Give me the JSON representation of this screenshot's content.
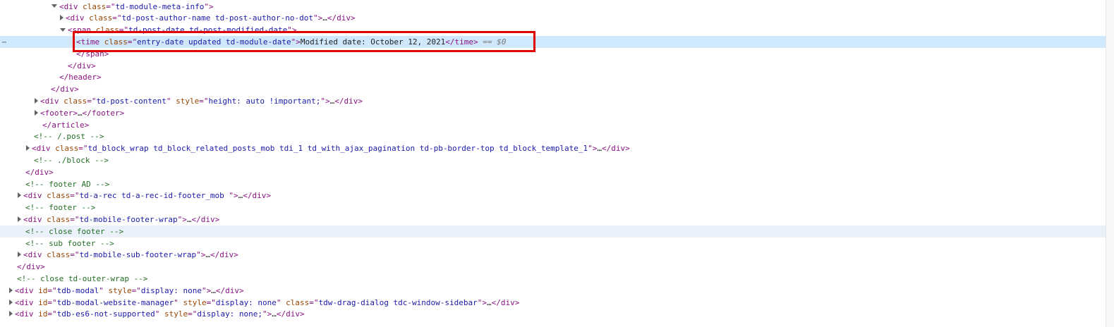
{
  "colors": {
    "tag": "#881280",
    "attr_name": "#994500",
    "attr_value": "#1a1aa6",
    "comment": "#236e25",
    "selected_row": "#cfe8fc",
    "highlight_box": "#e00000"
  },
  "gutter_dots": "⋯",
  "lines": [
    {
      "indent": 84,
      "tri": "open",
      "parts": [
        [
          "tag",
          "<div "
        ],
        [
          "an",
          "class"
        ],
        [
          "tag",
          "=\""
        ],
        [
          "av",
          "td-module-meta-info"
        ],
        [
          "tag",
          "\">"
        ]
      ]
    },
    {
      "indent": 96,
      "tri": "closed",
      "parts": [
        [
          "tag",
          "<div "
        ],
        [
          "an",
          "class"
        ],
        [
          "tag",
          "=\""
        ],
        [
          "av",
          "td-post-author-name td-post-author-no-dot"
        ],
        [
          "tag",
          "\">"
        ],
        [
          "ell",
          "…"
        ],
        [
          "tag",
          "</div>"
        ]
      ]
    },
    {
      "indent": 96,
      "tri": "open",
      "parts": [
        [
          "tag",
          "<span "
        ],
        [
          "an",
          "class"
        ],
        [
          "tag",
          "=\""
        ],
        [
          "av",
          "td-post-date td-post-modified-date"
        ],
        [
          "tag",
          "\">"
        ]
      ]
    },
    {
      "indent": 108,
      "tri": "none",
      "selected": true,
      "parts": [
        [
          "tag",
          "<time "
        ],
        [
          "an",
          "class"
        ],
        [
          "tag",
          "=\""
        ],
        [
          "av",
          "entry-date updated td-module-date"
        ],
        [
          "tag",
          "\">"
        ],
        [
          "txt",
          "Modified date: October 12, 2021"
        ],
        [
          "tag",
          "</time>"
        ],
        [
          "eq",
          " == $0"
        ]
      ]
    },
    {
      "indent": 108,
      "tri": "none",
      "parts": [
        [
          "tag",
          "</span>"
        ]
      ]
    },
    {
      "indent": 96,
      "tri": "none",
      "parts": [
        [
          "tag",
          "</div>"
        ]
      ]
    },
    {
      "indent": 84,
      "tri": "none",
      "parts": [
        [
          "tag",
          "</header>"
        ]
      ]
    },
    {
      "indent": 72,
      "tri": "none",
      "parts": [
        [
          "tag",
          "</div>"
        ]
      ]
    },
    {
      "indent": 60,
      "tri": "closed",
      "parts": [
        [
          "tag",
          "<div "
        ],
        [
          "an",
          "class"
        ],
        [
          "tag",
          "=\""
        ],
        [
          "av",
          "td-post-content"
        ],
        [
          "tag",
          "\" "
        ],
        [
          "an",
          "style"
        ],
        [
          "tag",
          "=\""
        ],
        [
          "av",
          "height: auto !important;"
        ],
        [
          "tag",
          "\">"
        ],
        [
          "ell",
          "…"
        ],
        [
          "tag",
          "</div>"
        ]
      ]
    },
    {
      "indent": 60,
      "tri": "closed",
      "parts": [
        [
          "tag",
          "<footer>"
        ],
        [
          "ell",
          "…"
        ],
        [
          "tag",
          "</footer>"
        ]
      ]
    },
    {
      "indent": 60,
      "tri": "none",
      "parts": [
        [
          "tag",
          "</article>"
        ]
      ]
    },
    {
      "indent": 48,
      "tri": "none",
      "parts": [
        [
          "cm",
          "<!-- /.post -->"
        ]
      ]
    },
    {
      "indent": 48,
      "tri": "closed",
      "parts": [
        [
          "tag",
          "<div "
        ],
        [
          "an",
          "class"
        ],
        [
          "tag",
          "=\""
        ],
        [
          "av",
          "td_block_wrap td_block_related_posts_mob tdi_1 td_with_ajax_pagination td-pb-border-top td_block_template_1"
        ],
        [
          "tag",
          "\">"
        ],
        [
          "ell",
          "…"
        ],
        [
          "tag",
          "</div>"
        ]
      ]
    },
    {
      "indent": 48,
      "tri": "none",
      "parts": [
        [
          "cm",
          "<!-- ./block -->"
        ]
      ]
    },
    {
      "indent": 36,
      "tri": "none",
      "parts": [
        [
          "tag",
          "</div>"
        ]
      ]
    },
    {
      "indent": 36,
      "tri": "none",
      "parts": [
        [
          "cm",
          "<!-- footer AD -->"
        ]
      ]
    },
    {
      "indent": 36,
      "tri": "closed",
      "parts": [
        [
          "tag",
          "<div "
        ],
        [
          "an",
          "class"
        ],
        [
          "tag",
          "=\""
        ],
        [
          "av",
          "td-a-rec td-a-rec-id-footer_mob "
        ],
        [
          "tag",
          "\">"
        ],
        [
          "ell",
          "…"
        ],
        [
          "tag",
          "</div>"
        ]
      ]
    },
    {
      "indent": 36,
      "tri": "none",
      "parts": [
        [
          "cm",
          "<!-- footer -->"
        ]
      ]
    },
    {
      "indent": 36,
      "tri": "closed",
      "parts": [
        [
          "tag",
          "<div "
        ],
        [
          "an",
          "class"
        ],
        [
          "tag",
          "=\""
        ],
        [
          "av",
          "td-mobile-footer-wrap"
        ],
        [
          "tag",
          "\">"
        ],
        [
          "ell",
          "…"
        ],
        [
          "tag",
          "</div>"
        ]
      ]
    },
    {
      "indent": 36,
      "tri": "none",
      "hover": true,
      "parts": [
        [
          "cm",
          "<!-- close footer -->"
        ]
      ]
    },
    {
      "indent": 36,
      "tri": "none",
      "parts": [
        [
          "cm",
          "<!-- sub footer -->"
        ]
      ]
    },
    {
      "indent": 36,
      "tri": "closed",
      "parts": [
        [
          "tag",
          "<div "
        ],
        [
          "an",
          "class"
        ],
        [
          "tag",
          "=\""
        ],
        [
          "av",
          "td-mobile-sub-footer-wrap"
        ],
        [
          "tag",
          "\">"
        ],
        [
          "ell",
          "…"
        ],
        [
          "tag",
          "</div>"
        ]
      ]
    },
    {
      "indent": 24,
      "tri": "none",
      "parts": [
        [
          "tag",
          "</div>"
        ]
      ]
    },
    {
      "indent": 24,
      "tri": "none",
      "parts": [
        [
          "cm",
          "<!-- close td-outer-wrap -->"
        ]
      ]
    },
    {
      "indent": 24,
      "tri": "closed",
      "parts": [
        [
          "tag",
          "<div "
        ],
        [
          "an",
          "id"
        ],
        [
          "tag",
          "=\""
        ],
        [
          "av",
          "tdb-modal"
        ],
        [
          "tag",
          "\" "
        ],
        [
          "an",
          "style"
        ],
        [
          "tag",
          "=\""
        ],
        [
          "av",
          "display: none"
        ],
        [
          "tag",
          "\">"
        ],
        [
          "ell",
          "…"
        ],
        [
          "tag",
          "</div>"
        ]
      ]
    },
    {
      "indent": 24,
      "tri": "closed",
      "parts": [
        [
          "tag",
          "<div "
        ],
        [
          "an",
          "id"
        ],
        [
          "tag",
          "=\""
        ],
        [
          "av",
          "tdb-modal-website-manager"
        ],
        [
          "tag",
          "\" "
        ],
        [
          "an",
          "style"
        ],
        [
          "tag",
          "=\""
        ],
        [
          "av",
          "display: none"
        ],
        [
          "tag",
          "\" "
        ],
        [
          "an",
          "class"
        ],
        [
          "tag",
          "=\""
        ],
        [
          "av",
          "tdw-drag-dialog tdc-window-sidebar"
        ],
        [
          "tag",
          "\">"
        ],
        [
          "ell",
          "…"
        ],
        [
          "tag",
          "</div>"
        ]
      ]
    },
    {
      "indent": 24,
      "tri": "closed",
      "parts": [
        [
          "tag",
          "<div "
        ],
        [
          "an",
          "id"
        ],
        [
          "tag",
          "=\""
        ],
        [
          "av",
          "tdb-es6-not-supported"
        ],
        [
          "tag",
          "\" "
        ],
        [
          "an",
          "style"
        ],
        [
          "tag",
          "=\""
        ],
        [
          "av",
          "display: none;"
        ],
        [
          "tag",
          "\">"
        ],
        [
          "ell",
          "…"
        ],
        [
          "tag",
          "</div>"
        ]
      ]
    }
  ]
}
